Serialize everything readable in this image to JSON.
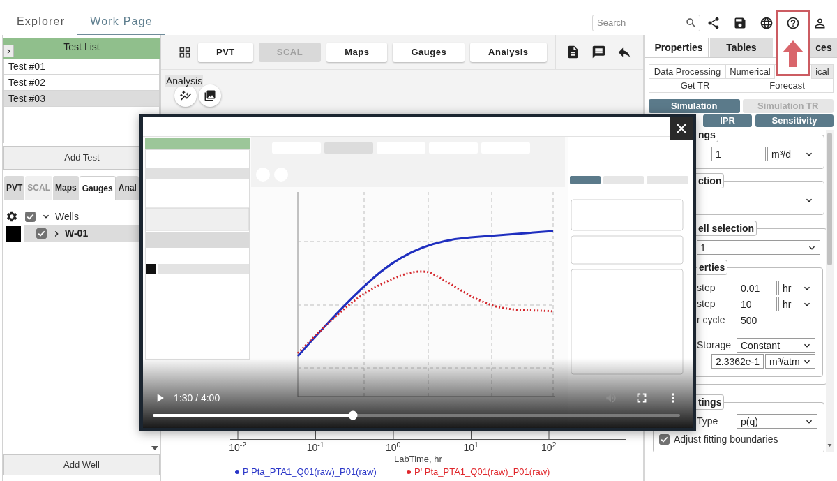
{
  "header": {
    "tabs": [
      {
        "label": "Explorer",
        "selected": false
      },
      {
        "label": "Work Page",
        "selected": true
      }
    ],
    "search": {
      "placeholder": "Search"
    }
  },
  "test_list": {
    "title": "Test List",
    "items": [
      {
        "label": "Test #01",
        "selected": false
      },
      {
        "label": "Test #02",
        "selected": false
      },
      {
        "label": "Test #03",
        "selected": true
      }
    ],
    "add_button": "Add Test"
  },
  "left_tabs": [
    {
      "label": "PVT",
      "selected": false,
      "disabled": false
    },
    {
      "label": "SCAL",
      "selected": false,
      "disabled": true
    },
    {
      "label": "Maps",
      "selected": false,
      "disabled": false
    },
    {
      "label": "Gauges",
      "selected": true,
      "disabled": false
    },
    {
      "label": "Anal",
      "selected": false,
      "disabled": false
    }
  ],
  "tree": [
    {
      "label": "Wells",
      "checked": true,
      "expanded": true,
      "children": [
        {
          "label": "W-01",
          "checked": true,
          "expanded": false,
          "selected": true,
          "color": "#000000"
        }
      ]
    }
  ],
  "add_well": "Add Well",
  "toolbar": {
    "buttons": [
      {
        "label": "PVT",
        "disabled": false
      },
      {
        "label": "SCAL",
        "disabled": true
      },
      {
        "label": "Maps",
        "disabled": false
      },
      {
        "label": "Gauges",
        "disabled": false
      },
      {
        "label": "Analysis",
        "disabled": false
      }
    ]
  },
  "analysis": {
    "label": "Analysis"
  },
  "chart": {
    "xticks": [
      "10$^{-2}$",
      "10$^{-1}$",
      "10$^{0}$",
      "10$^{1}$",
      "10$^{2}$"
    ],
    "xlabel": "LabTime, hr",
    "legend": [
      {
        "label": "P Pta_PTA1_Q01(raw)_P01(raw)",
        "color": "#2a36c8"
      },
      {
        "label": "P' Pta_PTA1_Q01(raw)_P01(raw)",
        "color": "#e0262b"
      }
    ]
  },
  "right_panel": {
    "tabs": [
      {
        "label": "Properties",
        "selected": true
      },
      {
        "label": "Tables",
        "selected": false
      },
      {
        "label": "ces",
        "selected": false
      }
    ],
    "method_rows": [
      [
        {
          "label": "Data Processing",
          "selected": false
        },
        {
          "label": "Numerical",
          "selected": false
        },
        {
          "label": "ical",
          "selected": true
        }
      ],
      [
        {
          "label": "Get TR",
          "selected": false
        },
        {
          "label": "Forecast",
          "selected": false
        }
      ]
    ],
    "mode_rows": [
      [
        {
          "label": "Simulation",
          "disabled": false
        },
        {
          "label": "Simulation TR",
          "disabled": true
        }
      ],
      [
        {
          "label": "IPR",
          "disabled": false
        },
        {
          "label": "Sensitivity",
          "disabled": false
        }
      ]
    ],
    "sections": [
      {
        "legend": "ngs",
        "rows": [
          {
            "kind": "pair",
            "value": "1",
            "unit": "m³/d"
          }
        ]
      },
      {
        "legend": "ction",
        "rows": [
          {
            "kind": "select"
          }
        ]
      },
      {
        "legend": "ell selection",
        "rows": [
          {
            "kind": "select",
            "value": "1"
          },
          {
            "kind": "group",
            "legend": "erties",
            "rows": [
              {
                "kind": "pair",
                "label": "step",
                "value": "0.01",
                "unit": "hr"
              },
              {
                "kind": "pair",
                "label": "step",
                "value": "10",
                "unit": "hr"
              },
              {
                "kind": "input",
                "label": "r cycle",
                "value": "500"
              },
              {
                "kind": "select",
                "label": "Storage",
                "value": "Constant"
              },
              {
                "kind": "pair",
                "value": "2.3362e-1",
                "unit": "m³/atm"
              }
            ]
          }
        ]
      },
      {
        "legend": "tings",
        "rows": [
          {
            "kind": "select",
            "label": "Type",
            "value": "p(q)"
          },
          {
            "kind": "checkbox",
            "label": "Adjust fitting boundaries",
            "checked": true
          }
        ]
      }
    ]
  },
  "video": {
    "playing": false,
    "time": "1:30 / 4:00",
    "level": 0.38
  }
}
